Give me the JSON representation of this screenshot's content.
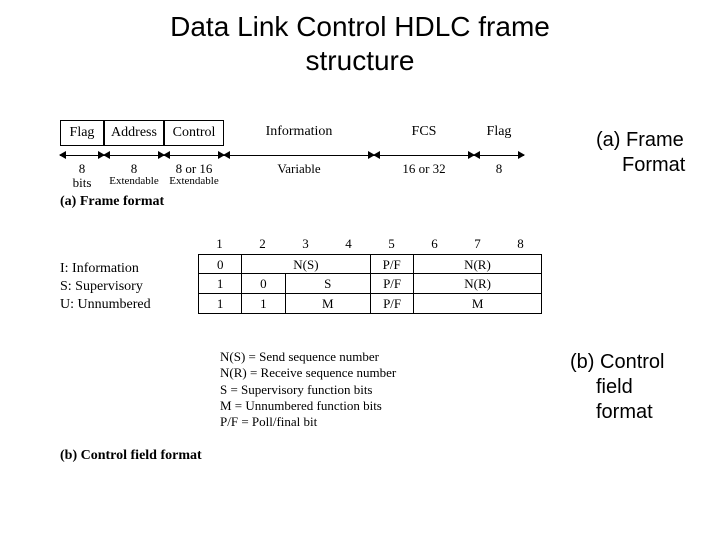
{
  "title_line1": "Data Link Control HDLC frame",
  "title_line2": "structure",
  "frame": {
    "cells": [
      "Flag",
      "Address",
      "Control",
      "Information",
      "FCS",
      "Flag"
    ],
    "dims": [
      "8",
      "8",
      "8 or 16",
      "Variable",
      "16 or 32",
      "8"
    ],
    "extra0": "bits",
    "extra1": "Extendable",
    "extra2": "Extendable",
    "caption": "(a) Frame format"
  },
  "legend": {
    "i": "I: Information",
    "s": "S: Supervisory",
    "u": "U: Unnumbered"
  },
  "bits": [
    "1",
    "2",
    "3",
    "4",
    "5",
    "6",
    "7",
    "8"
  ],
  "rows": {
    "r1": {
      "c1": "0",
      "ns": "N(S)",
      "pf": "P/F",
      "nr": "N(R)"
    },
    "r2": {
      "c1": "1",
      "c2": "0",
      "s": "S",
      "pf": "P/F",
      "nr": "N(R)"
    },
    "r3": {
      "c1": "1",
      "c2": "1",
      "m1": "M",
      "pf": "P/F",
      "m2": "M"
    }
  },
  "glossary": {
    "g1": "N(S) = Send sequence number",
    "g2": "N(R) = Receive sequence number",
    "g3": "S = Supervisory function bits",
    "g4": "M = Unnumbered function bits",
    "g5": "P/F = Poll/final bit"
  },
  "caption_b": "(b) Control field format",
  "ann_a_l1": "(a) Frame",
  "ann_a_l2": "Format",
  "ann_b_l1": "(b) Control",
  "ann_b_l2": "field",
  "ann_b_l3": "format"
}
